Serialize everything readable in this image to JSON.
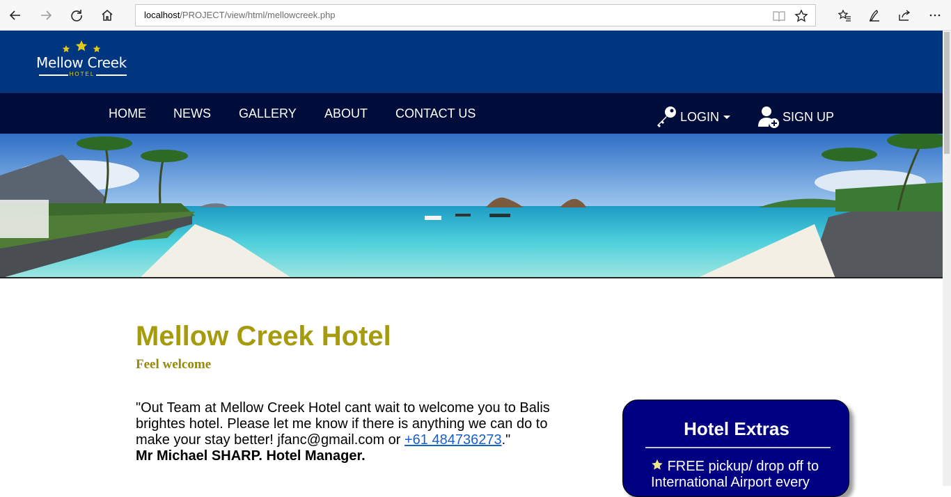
{
  "browser": {
    "url_host": "localhost",
    "url_path": "/PROJECT/view/html/mellowcreek.php"
  },
  "site": {
    "logo_name": "Mellow Creek",
    "logo_subtitle": "HOTEL"
  },
  "nav": {
    "items": [
      {
        "label": "HOME"
      },
      {
        "label": "NEWS"
      },
      {
        "label": "GALLERY"
      },
      {
        "label": "ABOUT"
      },
      {
        "label": "CONTACT US"
      }
    ],
    "login_label": "LOGIN",
    "signup_label": "SIGN UP"
  },
  "main": {
    "title": "Mellow Creek Hotel",
    "subtitle": "Feel welcome",
    "quote_text": "\"Out Team at Mellow Creek Hotel cant wait to welcome you to Balis brightes hotel. Please let me know if there is anything we can do to make your stay better! jfanc@gmail.com or ",
    "phone_link": "+61 484736273",
    "quote_end": ".\"",
    "signature": "Mr Michael SHARP. Hotel Manager."
  },
  "extras": {
    "title": "Hotel Extras",
    "items": [
      {
        "text": "FREE pickup/ drop off to International Airport every"
      }
    ]
  },
  "colors": {
    "header_blue": "#00357f",
    "nav_navy": "#000c3a",
    "title_gold": "#a59b0d",
    "extras_blue": "#000080"
  }
}
